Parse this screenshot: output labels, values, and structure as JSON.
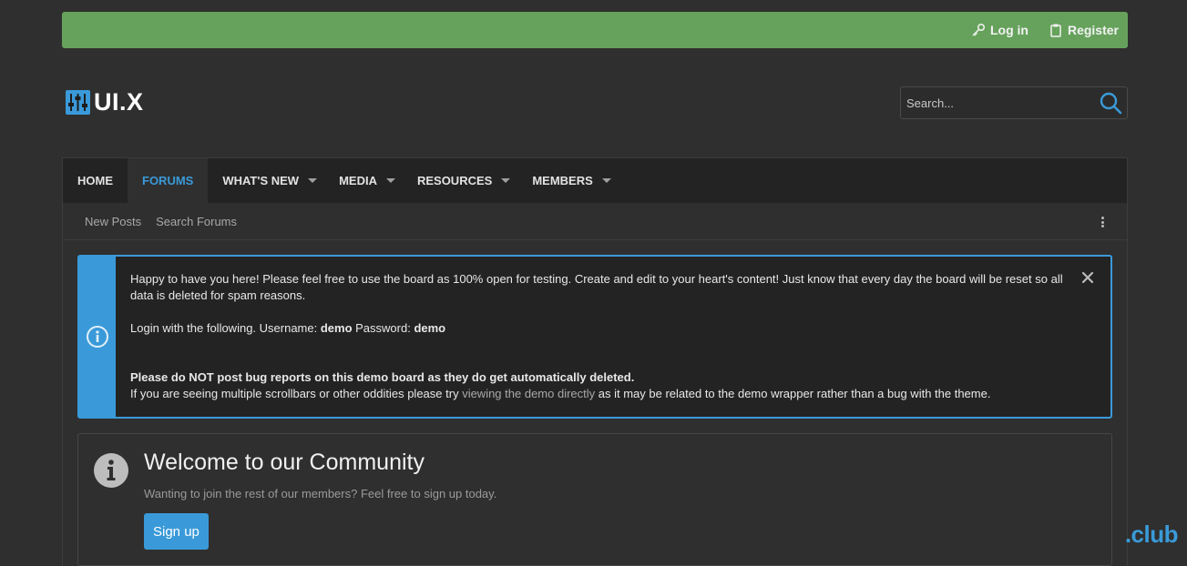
{
  "topbar": {
    "login_label": "Log in",
    "register_label": "Register",
    "color": "#66a25c"
  },
  "logo": {
    "text": "UI.X"
  },
  "search": {
    "placeholder": "Search..."
  },
  "nav": {
    "tabs": [
      {
        "label": "HOME",
        "active": false,
        "dropdown": false
      },
      {
        "label": "FORUMS",
        "active": true,
        "dropdown": false
      },
      {
        "label": "WHAT'S NEW",
        "active": false,
        "dropdown": true
      },
      {
        "label": "MEDIA",
        "active": false,
        "dropdown": true
      },
      {
        "label": "RESOURCES",
        "active": false,
        "dropdown": true
      },
      {
        "label": "MEMBERS",
        "active": false,
        "dropdown": true
      }
    ],
    "accent": "#3a9ad9"
  },
  "subnav": {
    "links": [
      "New Posts",
      "Search Forums"
    ]
  },
  "notice": {
    "line1": "Happy to have you here! Please feel free to use the board as 100% open for testing. Create and edit to your heart's content! Just know that every day the board will be reset so all data is deleted for spam reasons.",
    "login_prefix": "Login with the following. Username: ",
    "username": "demo",
    "password_label": " Password: ",
    "password": "demo",
    "warning_bold": "Please do NOT post bug reports on this demo board as they do get automatically deleted.",
    "scroll_prefix": "If you are seeing multiple scrollbars or other oddities please try ",
    "scroll_link": "viewing the demo directly",
    "scroll_suffix": " as it may be related to the demo wrapper rather than a bug with the theme."
  },
  "welcome": {
    "title": "Welcome to our Community",
    "subtitle": "Wanting to join the rest of our members? Feel free to sign up today.",
    "signup_label": "Sign up"
  },
  "watermark": ".club"
}
